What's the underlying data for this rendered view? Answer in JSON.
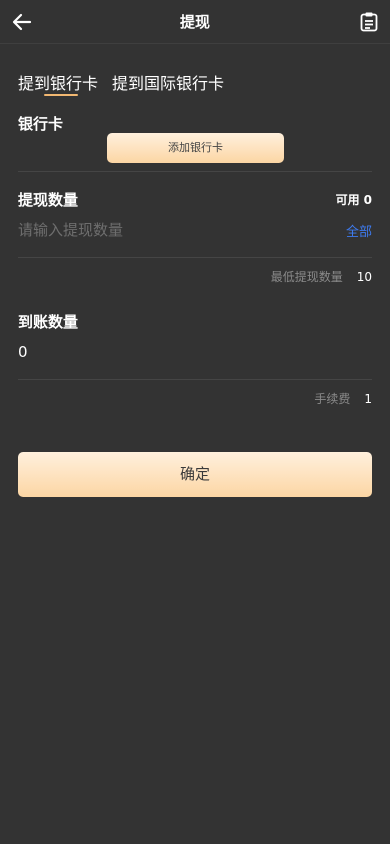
{
  "header": {
    "title": "提现",
    "back_icon": "arrow-left-icon",
    "record_icon": "clipboard-list-icon"
  },
  "tabs": [
    {
      "label": "提到银行卡",
      "active": true
    },
    {
      "label": "提到国际银行卡",
      "active": false
    }
  ],
  "bank_card": {
    "label": "银行卡",
    "add_button": "添加银行卡"
  },
  "withdraw": {
    "label": "提现数量",
    "available_label": "可用",
    "available_value": "0",
    "input_placeholder": "请输入提现数量",
    "input_value": "",
    "all_button": "全部",
    "min_label": "最低提现数量",
    "min_value": "10"
  },
  "receive": {
    "label": "到账数量",
    "value": "0",
    "fee_label": "手续费",
    "fee_value": "1"
  },
  "confirm_button": "确定",
  "colors": {
    "background": "#333333",
    "accent_gold": "#f2b872",
    "link_blue": "#3e7bf0"
  }
}
